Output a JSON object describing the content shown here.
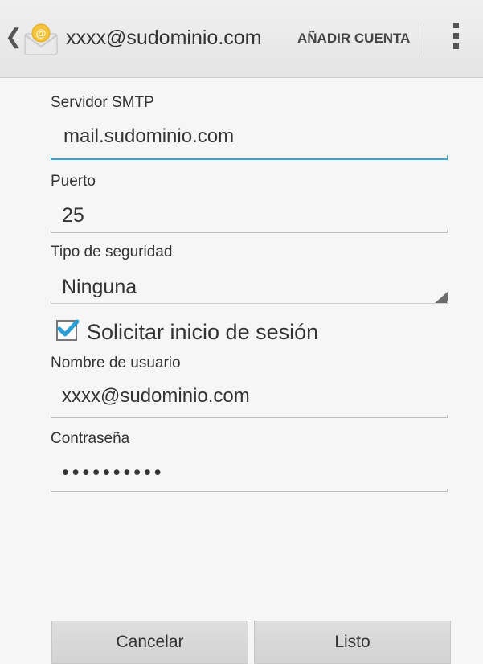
{
  "header": {
    "account_email": "xxxx@sudominio.com",
    "add_account_label": "AÑADIR CUENTA"
  },
  "form": {
    "smtp_server": {
      "label": "Servidor SMTP",
      "value": "mail.sudominio.com"
    },
    "port": {
      "label": "Puerto",
      "value": "25"
    },
    "security_type": {
      "label": "Tipo de seguridad",
      "selected": "Ninguna"
    },
    "require_login": {
      "label": "Solicitar inicio de sesión",
      "checked": true
    },
    "username": {
      "label": "Nombre de usuario",
      "value": "xxxx@sudominio.com"
    },
    "password": {
      "label": "Contraseña",
      "masked_value": "••••••••••"
    }
  },
  "buttons": {
    "cancel_label": "Cancelar",
    "done_label": "Listo"
  },
  "colors": {
    "accent": "#33a6d8",
    "checkmark": "#2a9fd6",
    "envelope_icon": "#f5c33b"
  },
  "icons": [
    "back-chevron-icon",
    "email-app-icon",
    "overflow-menu-icon",
    "dropdown-arrow-icon",
    "checkmark-icon"
  ]
}
